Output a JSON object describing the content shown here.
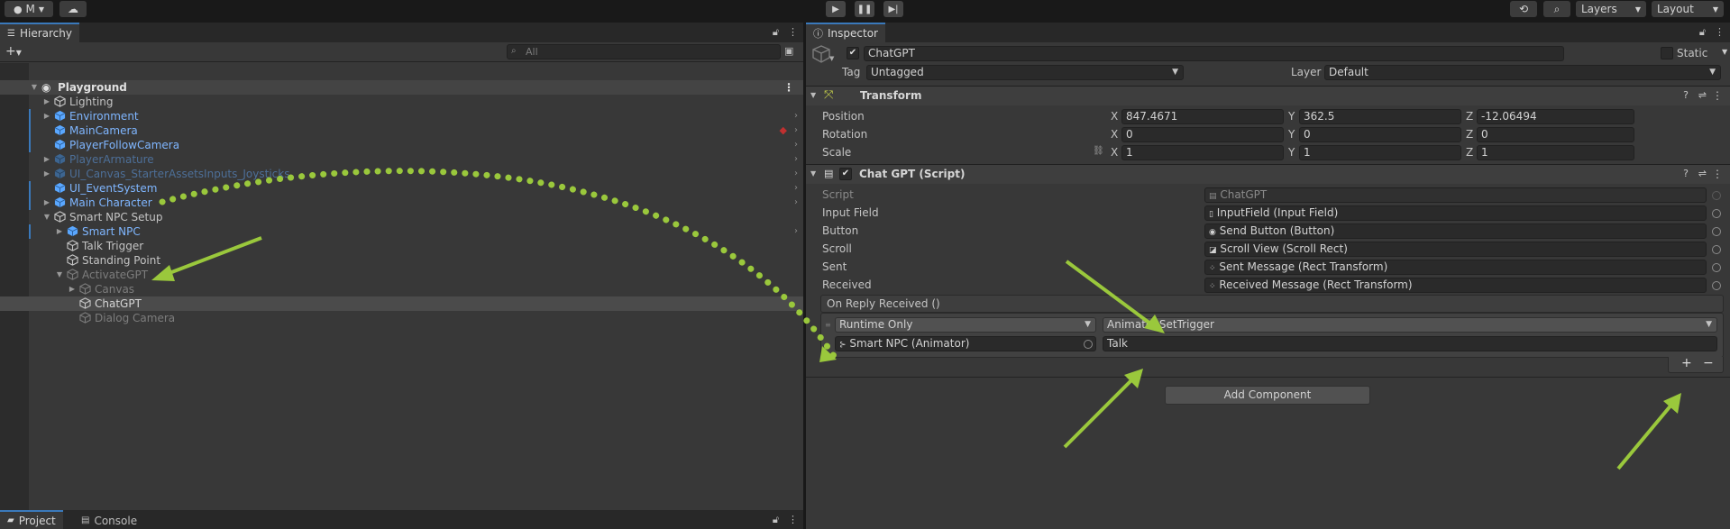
{
  "toolbar": {
    "account_label": "M",
    "layers_label": "Layers",
    "layout_label": "Layout"
  },
  "hierarchy": {
    "tab_label": "Hierarchy",
    "search_placeholder": "All",
    "scene_name": "Playground",
    "items": [
      {
        "label": "Lighting"
      },
      {
        "label": "Environment"
      },
      {
        "label": "MainCamera"
      },
      {
        "label": "PlayerFollowCamera"
      },
      {
        "label": "PlayerArmature"
      },
      {
        "label": "UI_Canvas_StarterAssetsInputs_Joysticks"
      },
      {
        "label": "UI_EventSystem"
      },
      {
        "label": "Main Character"
      },
      {
        "label": "Smart NPC Setup"
      },
      {
        "label": "Smart NPC"
      },
      {
        "label": "Talk Trigger"
      },
      {
        "label": "Standing Point"
      },
      {
        "label": "ActivateGPT"
      },
      {
        "label": "Canvas"
      },
      {
        "label": "ChatGPT"
      },
      {
        "label": "Dialog Camera"
      }
    ]
  },
  "bottom_tabs": {
    "project_label": "Project",
    "console_label": "Console"
  },
  "inspector": {
    "tab_label": "Inspector",
    "object_name": "ChatGPT",
    "static_label": "Static",
    "tag_label": "Tag",
    "tag_value": "Untagged",
    "layer_label": "Layer",
    "layer_value": "Default",
    "transform": {
      "title": "Transform",
      "position_label": "Position",
      "rotation_label": "Rotation",
      "scale_label": "Scale",
      "axis_x": "X",
      "axis_y": "Y",
      "axis_z": "Z",
      "position": [
        "847.4671",
        "362.5",
        "-12.06494"
      ],
      "rotation": [
        "0",
        "0",
        "0"
      ],
      "scale": [
        "1",
        "1",
        "1"
      ]
    },
    "script_component": {
      "title": "Chat GPT (Script)",
      "script_label": "Script",
      "script_value": "ChatGPT",
      "input_field_label": "Input Field",
      "input_field_value": "InputField (Input Field)",
      "button_label": "Button",
      "button_value": "Send Button (Button)",
      "scroll_label": "Scroll",
      "scroll_value": "Scroll View (Scroll Rect)",
      "sent_label": "Sent",
      "sent_value": "Sent Message (Rect Transform)",
      "received_label": "Received",
      "received_value": "Received Message (Rect Transform)",
      "event_title": "On Reply Received ()",
      "event_mode": "Runtime Only",
      "event_function": "Animator.SetTrigger",
      "event_target": "Smart NPC (Animator)",
      "event_argument": "Talk",
      "add_symbol": "+",
      "remove_symbol": "−"
    },
    "add_component_label": "Add Component"
  },
  "colors": {
    "accent": "#3a79bb",
    "arrow": "#9ac83c",
    "prefab_blue": "#7fb6ff"
  }
}
